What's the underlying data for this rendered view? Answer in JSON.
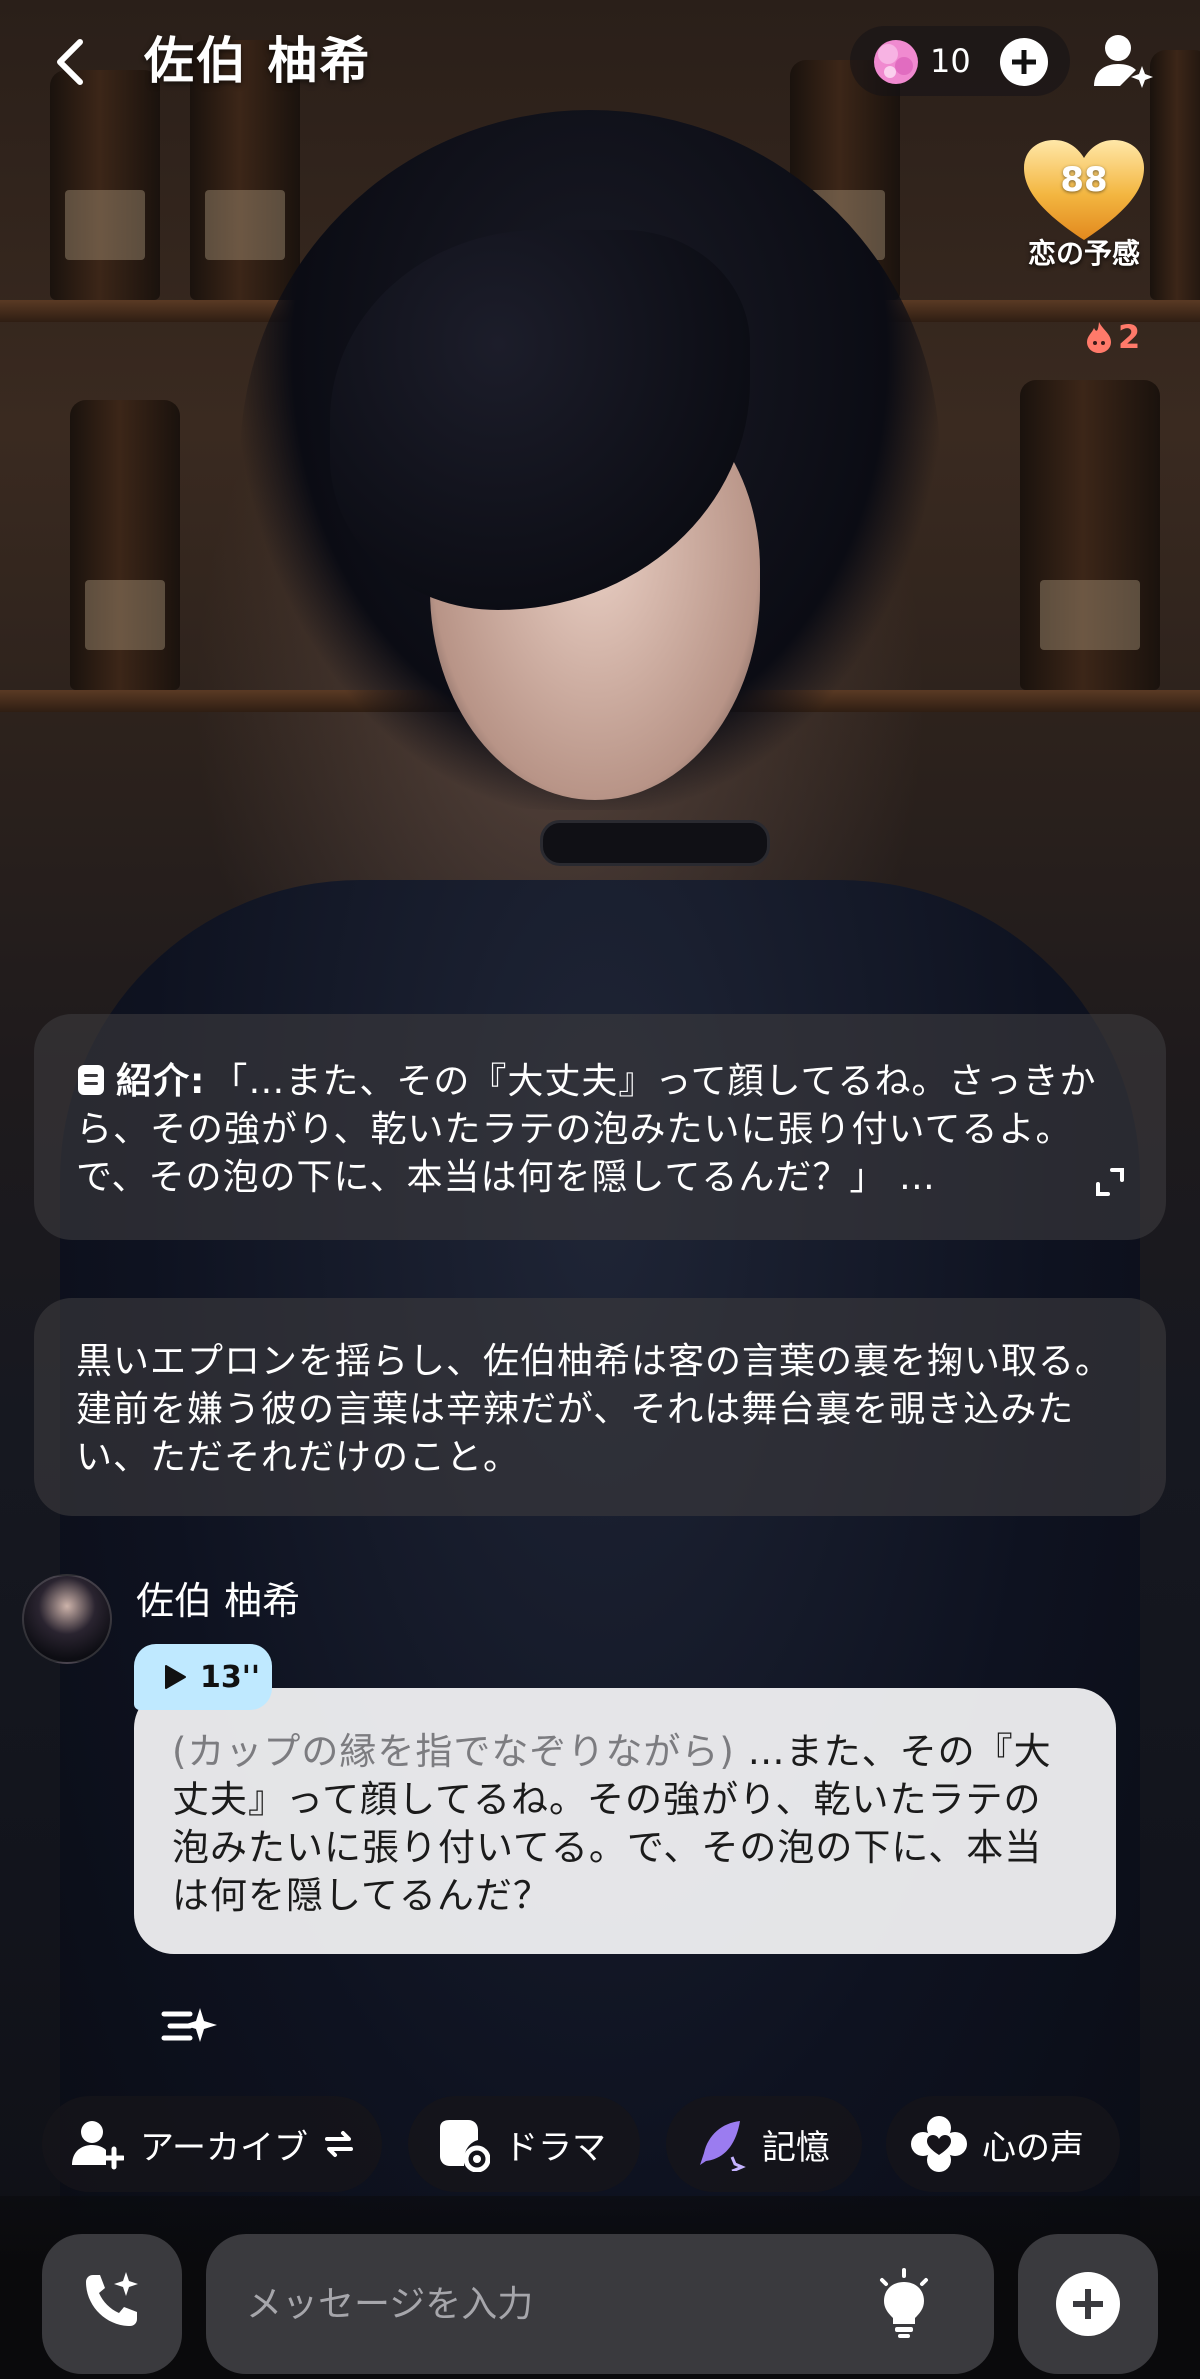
{
  "header": {
    "title": "佐伯 柚希",
    "gem_count": "10"
  },
  "affection": {
    "value": "88",
    "label": "恋の予感"
  },
  "flame": {
    "count": "2"
  },
  "intro": {
    "label": "紹介:",
    "text": "「…また、その『大丈夫』って顔してるね。さっきから、その強がり、乾いたラテの泡みたいに張り付いてるよ。で、その泡の下に、本当は何を隠してるんだ？」 …"
  },
  "narration": {
    "text": "黒いエプロンを揺らし、佐伯柚希は客の言葉の裏を掬い取る。建前を嫌う彼の言葉は辛辣だが、それは舞台裏を覗き込みたい、ただそれだけのこと。"
  },
  "message": {
    "sender": "佐伯 柚希",
    "voice_duration": "13''",
    "action": "(カップの縁を指でなぞりながら)",
    "text": " …また、その『大丈夫』って顔してるね。その強がり、乾いたラテの泡みたいに張り付いてる。で、その泡の下に、本当は何を隠してるんだ？"
  },
  "quick_actions": {
    "archive": "アーカイブ",
    "drama": "ドラマ",
    "memory": "記憶",
    "heart_voice": "心の声"
  },
  "input": {
    "placeholder": "メッセージを入力"
  },
  "colors": {
    "voice_pill": "#bfe9ff",
    "heart_gold": "#f3b640",
    "flame_red": "#ff7a6a",
    "gem_pink": "#f08ad0",
    "memory_purple": "#9b7cf0"
  },
  "icons": [
    "back-chevron-icon",
    "gem-icon",
    "plus-icon",
    "add-user-sparkle-icon",
    "heart-icon",
    "flame-icon",
    "document-icon",
    "expand-icon",
    "play-icon",
    "sparkle-arrow-icon",
    "add-user-icon",
    "swap-icon",
    "drama-gear-icon",
    "quill-icon",
    "flower-heart-icon",
    "phone-sparkle-icon",
    "lightbulb-icon"
  ]
}
